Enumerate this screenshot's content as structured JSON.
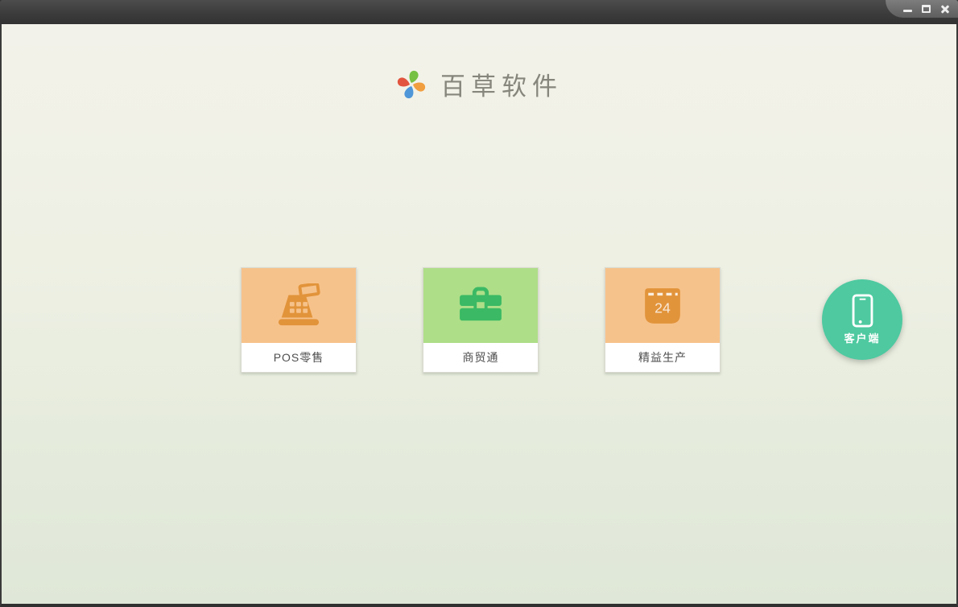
{
  "window": {
    "controls": [
      {
        "name": "minimize",
        "icon": "minimize-icon"
      },
      {
        "name": "maximize",
        "icon": "maximize-icon"
      },
      {
        "name": "close",
        "icon": "close-icon"
      }
    ],
    "titlebar_color": "#3c3c3c"
  },
  "brand": {
    "name": "百草软件",
    "logo_icon": "pinwheel-icon",
    "logo_colors": {
      "top": "#76c043",
      "right": "#f09e3f",
      "bottom": "#4f96d8",
      "left": "#e2543e"
    },
    "name_color": "#87867c"
  },
  "products": [
    {
      "label": "POS零售",
      "icon": "cash-register-icon",
      "tile_color": "#f6c28b",
      "icon_color": "#e2943b"
    },
    {
      "label": "商贸通",
      "icon": "briefcase-icon",
      "tile_color": "#aede88",
      "icon_color": "#3bb964"
    },
    {
      "label": "精益生产",
      "icon": "calendar-icon",
      "tile_color": "#f6c28b",
      "icon_color": "#e2943b",
      "calendar_day": "24"
    }
  ],
  "client": {
    "label": "客户端",
    "icon": "smartphone-icon",
    "color": "#4ec9a0"
  },
  "background": {
    "top": "#f3f2ea",
    "bottom": "#dfe7d8"
  }
}
